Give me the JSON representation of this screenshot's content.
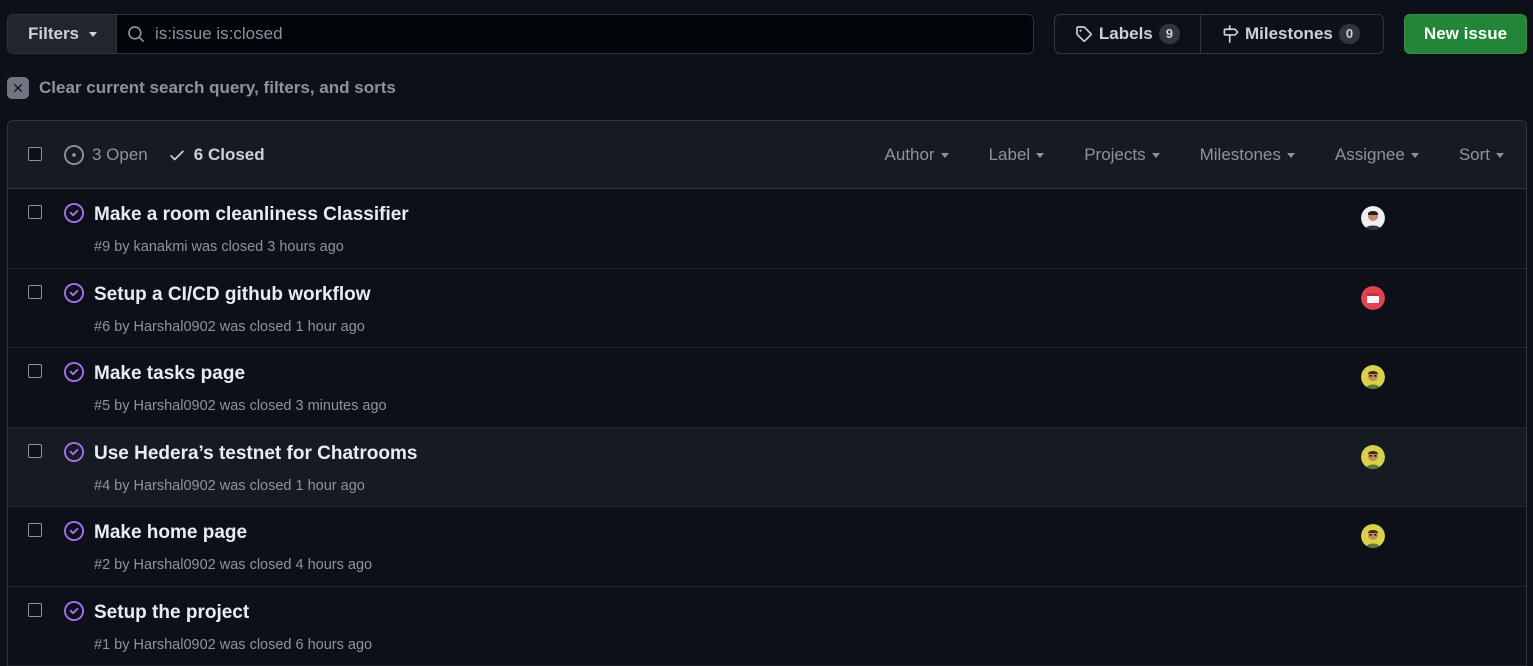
{
  "toolbar": {
    "filters_label": "Filters",
    "search_value": "is:issue is:closed",
    "labels_label": "Labels",
    "labels_count": "9",
    "milestones_label": "Milestones",
    "milestones_count": "0",
    "new_issue_label": "New issue"
  },
  "clear_text": "Clear current search query, filters, and sorts",
  "header": {
    "open_label": "3 Open",
    "closed_label": "6 Closed",
    "filters": [
      "Author",
      "Label",
      "Projects",
      "Milestones",
      "Assignee",
      "Sort"
    ]
  },
  "colors": {
    "accent_green": "#238636",
    "closed_purple": "#a371f7"
  },
  "issues": [
    {
      "title": "Make a room cleanliness Classifier",
      "meta": "#9 by kanakmi was closed 3 hours ago",
      "avatar": "avatar-kanakmi"
    },
    {
      "title": "Setup a CI/CD github workflow",
      "meta": "#6 by Harshal0902 was closed 1 hour ago",
      "avatar": "avatar-red"
    },
    {
      "title": "Make tasks page",
      "meta": "#5 by Harshal0902 was closed 3 minutes ago",
      "avatar": "avatar-yellow"
    },
    {
      "title": "Use Hedera’s testnet for Chatrooms",
      "meta": "#4 by Harshal0902 was closed 1 hour ago",
      "avatar": "avatar-yellow"
    },
    {
      "title": "Make home page",
      "meta": "#2 by Harshal0902 was closed 4 hours ago",
      "avatar": "avatar-yellow"
    },
    {
      "title": "Setup the project",
      "meta": "#1 by Harshal0902 was closed 6 hours ago",
      "avatar": ""
    }
  ]
}
